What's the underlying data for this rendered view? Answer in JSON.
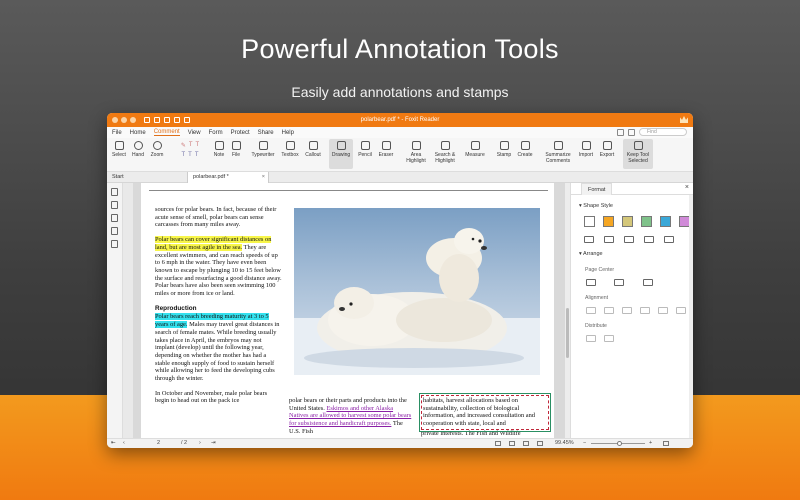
{
  "hero": {
    "title": "Powerful Annotation Tools",
    "subtitle": "Easily add annotations and stamps"
  },
  "window": {
    "title": "polarbear.pdf * - Foxit Reader"
  },
  "menu": {
    "items": [
      "File",
      "Home",
      "Comment",
      "View",
      "Form",
      "Protect",
      "Share",
      "Help"
    ],
    "active": "Comment",
    "search_placeholder": "Find"
  },
  "ribbon": {
    "select": "Select",
    "hand": "Hand",
    "zoom": "Zoom",
    "note": "Note",
    "file": "File",
    "typewriter": "Typewriter",
    "textbox": "Textbox",
    "callout": "Callout",
    "drawing": "Drawing",
    "pencil": "Pencil",
    "eraser": "Eraser",
    "area_highlight_1": "Area",
    "area_highlight_2": "Highlight",
    "search_highlight_1": "Search &",
    "search_highlight_2": "Highlight",
    "measure": "Measure",
    "stamp": "Stamp",
    "create": "Create",
    "summarize_1": "Summarize",
    "summarize_2": "Comments",
    "import": "Import",
    "export": "Export",
    "keep_tool_1": "Keep Tool",
    "keep_tool_2": "Selected"
  },
  "tabs": {
    "start": "Start",
    "doc": "polarbear.pdf *"
  },
  "document": {
    "left_p1": "sources for polar bears. In fact, because of their acute sense of smell, polar bears can sense carcasses from many miles away.",
    "left_p2_hl": "Polar bears can cover significant distances on land, but are most agile in the sea.",
    "left_p2_rest": " They are excellent swimmers, and can reach speeds of up to 6 mph in the water. They have even been known to escape by plunging 10 to 15 feet below the surface and resurfacing a good distance away. Polar bears have also been seen swimming 100 miles or more from ice or land.",
    "reproduction_heading": "Reproduction",
    "left_p3_hl": "Polar bears reach breeding maturity at 3 to 5 years of age.",
    "left_p3_rest": " Males may travel great distances in search of female mates. While breeding usually takes place in April, the embryos may not implant (develop) until the following year, depending on whether the mother has had a stable enough supply of food to sustain herself while allowing her to feed the developing cubs through the winter.",
    "left_p4": "In October and November, male polar bears begin to head out on the pack ice",
    "mid_text": "polar bears or their parts and products into the United States.",
    "mid_strike": "Eskimos and other Alaska Natives are allowed to harvest some polar bears for subsistence and handicraft purposes.",
    "mid_tail": " The U.S. Fish",
    "right_boxed": "habitats, harvest allocations based on sustainability, collection of biological information, and increased consultation and cooperation with state, local and",
    "right_tail": " private interests. The Fish and Wildlife"
  },
  "panel": {
    "tab": "Format",
    "shape_style": "Shape Style",
    "arrange": "Arrange",
    "page_center": "Page Center",
    "alignment": "Alignment",
    "distribute": "Distribute",
    "swatches": [
      "#ffffff",
      "#f5a623",
      "#d4c77a",
      "#7fc28a",
      "#3aa8d8",
      "#d08ad8"
    ]
  },
  "status": {
    "page_current": "2",
    "page_total": "/ 2",
    "zoom": "99.45%"
  },
  "colors": {
    "accent": "#f07a12",
    "highlight_yellow": "#f8f64a",
    "highlight_cyan": "#34e1ee",
    "strike_purple": "#8a1fa6"
  }
}
